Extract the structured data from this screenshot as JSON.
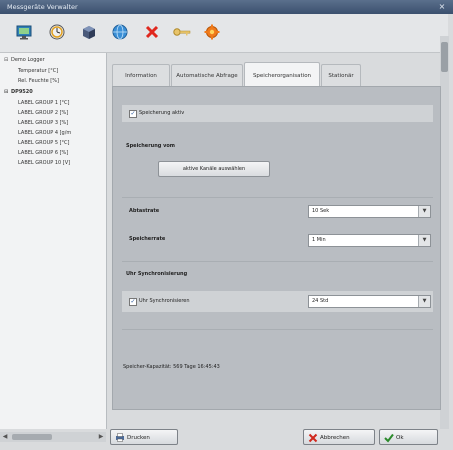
{
  "window": {
    "title": "Messgeräte Verwalter",
    "close_glyph": "×"
  },
  "toolbar": {
    "icons": [
      "monitor-icon",
      "clock-icon",
      "cube-icon",
      "globe-icon",
      "delete-icon",
      "key-icon",
      "settings-gear-icon"
    ]
  },
  "tree": {
    "items": [
      {
        "expander": "⊟",
        "label": "Demo Logger",
        "bold": false
      },
      {
        "expander": "",
        "label": "Temperatur [°C]",
        "bold": false
      },
      {
        "expander": "",
        "label": "Rel. Feuchte [%]",
        "bold": false
      },
      {
        "expander": "⊟",
        "label": "DP9520",
        "bold": true
      },
      {
        "expander": "",
        "label": "LABEL GROUP 1 [°C]",
        "bold": false
      },
      {
        "expander": "",
        "label": "LABEL GROUP 2 [%]",
        "bold": false
      },
      {
        "expander": "",
        "label": "LABEL GROUP 3 [%]",
        "bold": false
      },
      {
        "expander": "",
        "label": "LABEL GROUP 4 [g/m",
        "bold": false
      },
      {
        "expander": "",
        "label": "LABEL GROUP 5 [°C]",
        "bold": false
      },
      {
        "expander": "",
        "label": "LABEL GROUP 6 [%]",
        "bold": false
      },
      {
        "expander": "",
        "label": "LABEL GROUP 10 [V]",
        "bold": false
      }
    ]
  },
  "tabs": [
    {
      "label": "Information",
      "active": false
    },
    {
      "label": "Automatische Abfrage",
      "active": false
    },
    {
      "label": "Speicherorganisation",
      "active": true
    },
    {
      "label": "Stationär",
      "active": false
    }
  ],
  "panel": {
    "storage_active_label": "Speicherung aktiv",
    "storage_from_heading": "Speicherung vom",
    "select_channels_button": "aktive Kanäle auswählen",
    "measure_rate_label": "Abtastrate",
    "measure_rate_value": "10 Sek",
    "storage_rate_label": "Speicherrate",
    "storage_rate_value": "1 Min",
    "clock_sync_heading": "Uhr Synchronisierung",
    "clock_sync_checkbox_label": "Uhr Synchronisieren",
    "clock_sync_value": "24 Std",
    "capacity_text": "Speicher-Kapazität: 569 Tage 16:45:43"
  },
  "footer": {
    "print_label": "Drucken",
    "cancel_label": "Abbrechen",
    "ok_label": "Ok"
  },
  "colors": {
    "accent": "#2b5a9e",
    "titlebar": "#3b506e",
    "panel": "#b9bdc2"
  }
}
